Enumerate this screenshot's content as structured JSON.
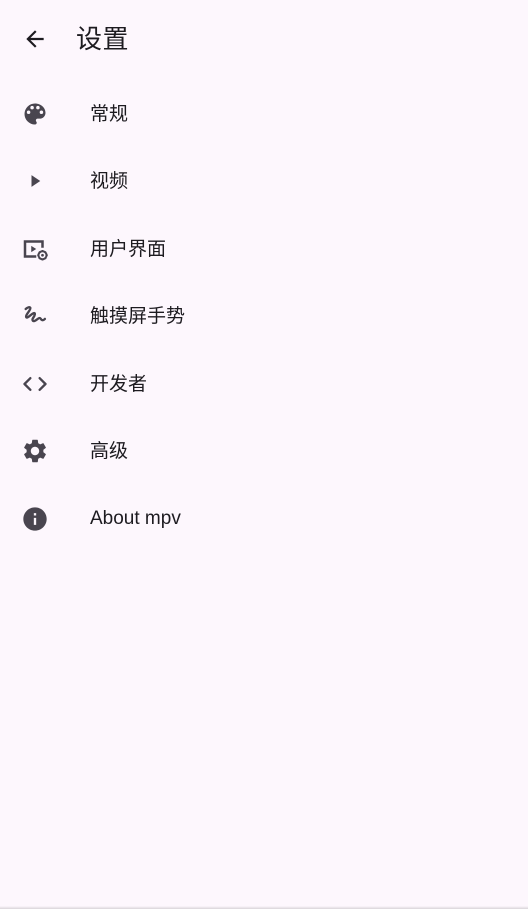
{
  "appbar": {
    "title": "设置",
    "back_icon": "arrow-back-icon"
  },
  "colors": {
    "background": "#fdf7fd",
    "text": "#1d1b20",
    "icon": "#49454f"
  },
  "menu": {
    "items": [
      {
        "label": "常规",
        "icon": "palette-icon"
      },
      {
        "label": "视频",
        "icon": "play-arrow-icon"
      },
      {
        "label": "用户界面",
        "icon": "video-settings-icon"
      },
      {
        "label": "触摸屏手势",
        "icon": "gesture-icon"
      },
      {
        "label": "开发者",
        "icon": "code-icon"
      },
      {
        "label": "高级",
        "icon": "settings-gear-icon"
      },
      {
        "label": "About mpv",
        "icon": "info-icon"
      }
    ]
  }
}
